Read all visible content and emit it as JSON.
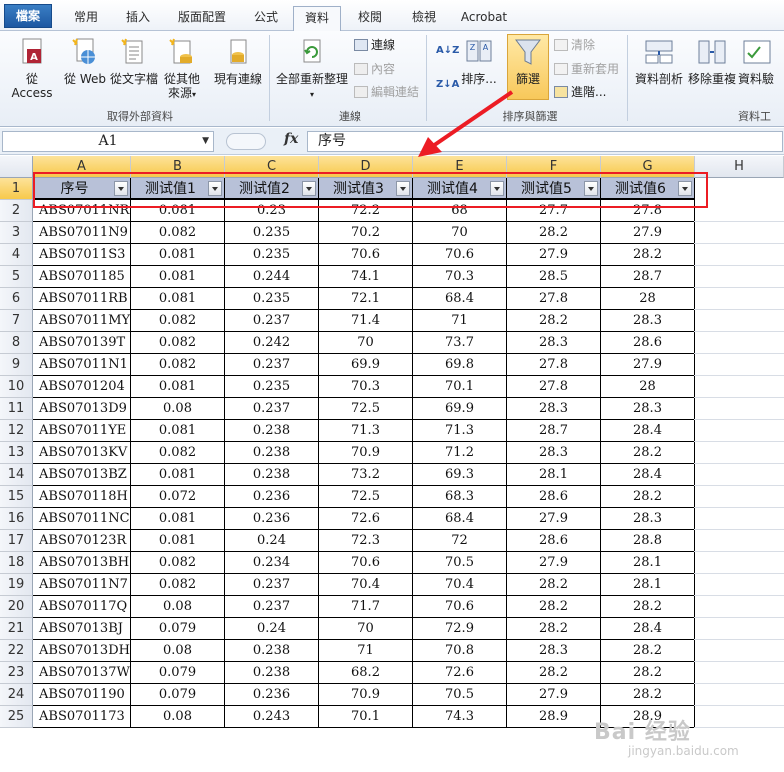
{
  "tabs": [
    "檔案",
    "常用",
    "插入",
    "版面配置",
    "公式",
    "資料",
    "校閱",
    "檢視",
    "Acrobat"
  ],
  "ribbon": {
    "get_external": {
      "buttons": [
        "從 Access",
        "從 Web",
        "從文字檔",
        "從其他",
        "來源",
        "現有連線"
      ],
      "label": "取得外部資料"
    },
    "connections": {
      "refresh_all": "全部重新整理",
      "connections": "連線",
      "properties": "內容",
      "edit_links": "編輯連結",
      "label": "連線"
    },
    "sort_filter": {
      "sort": "排序...",
      "filter": "篩選",
      "clear": "清除",
      "reapply": "重新套用",
      "advanced": "進階...",
      "label": "排序與篩選"
    },
    "data_tools": {
      "text_to_columns": "資料剖析",
      "remove_duplicates": "移除重複",
      "more": "資料驗",
      "label": "資料工"
    }
  },
  "formula_bar": {
    "name_box": "A1",
    "fx": "fx",
    "content": "序号"
  },
  "columns": [
    "A",
    "B",
    "C",
    "D",
    "E",
    "F",
    "G",
    "H"
  ],
  "headers": [
    "序号",
    "测试值1",
    "测试值2",
    "测试值3",
    "测试值4",
    "测试值5",
    "测试值6"
  ],
  "rows": [
    [
      "ABS07011NR",
      "0.081",
      "0.23",
      "72.2",
      "68",
      "27.7",
      "27.8"
    ],
    [
      "ABS07011N9",
      "0.082",
      "0.235",
      "70.2",
      "70",
      "28.2",
      "27.9"
    ],
    [
      "ABS07011S3",
      "0.081",
      "0.235",
      "70.6",
      "70.6",
      "27.9",
      "28.2"
    ],
    [
      "ABS0701185",
      "0.081",
      "0.244",
      "74.1",
      "70.3",
      "28.5",
      "28.7"
    ],
    [
      "ABS07011RB",
      "0.081",
      "0.235",
      "72.1",
      "68.4",
      "27.8",
      "28"
    ],
    [
      "ABS07011MY",
      "0.082",
      "0.237",
      "71.4",
      "71",
      "28.2",
      "28.3"
    ],
    [
      "ABS070139T",
      "0.082",
      "0.242",
      "70",
      "73.7",
      "28.3",
      "28.6"
    ],
    [
      "ABS07011N1",
      "0.082",
      "0.237",
      "69.9",
      "69.8",
      "27.8",
      "27.9"
    ],
    [
      "ABS0701204",
      "0.081",
      "0.235",
      "70.3",
      "70.1",
      "27.8",
      "28"
    ],
    [
      "ABS07013D9",
      "0.08",
      "0.237",
      "72.5",
      "69.9",
      "28.3",
      "28.3"
    ],
    [
      "ABS07011YE",
      "0.081",
      "0.238",
      "71.3",
      "71.3",
      "28.7",
      "28.4"
    ],
    [
      "ABS07013KV",
      "0.082",
      "0.238",
      "70.9",
      "71.2",
      "28.3",
      "28.2"
    ],
    [
      "ABS07013BZ",
      "0.081",
      "0.238",
      "73.2",
      "69.3",
      "28.1",
      "28.4"
    ],
    [
      "ABS070118H",
      "0.072",
      "0.236",
      "72.5",
      "68.3",
      "28.6",
      "28.2"
    ],
    [
      "ABS07011NC",
      "0.081",
      "0.236",
      "72.6",
      "68.4",
      "27.9",
      "28.3"
    ],
    [
      "ABS070123R",
      "0.081",
      "0.24",
      "72.3",
      "72",
      "28.6",
      "28.8"
    ],
    [
      "ABS07013BH",
      "0.082",
      "0.234",
      "70.6",
      "70.5",
      "27.9",
      "28.1"
    ],
    [
      "ABS07011N7",
      "0.082",
      "0.237",
      "70.4",
      "70.4",
      "28.2",
      "28.1"
    ],
    [
      "ABS070117Q",
      "0.08",
      "0.237",
      "71.7",
      "70.6",
      "28.2",
      "28.2"
    ],
    [
      "ABS07013BJ",
      "0.079",
      "0.24",
      "70",
      "72.9",
      "28.2",
      "28.4"
    ],
    [
      "ABS07013DH",
      "0.08",
      "0.238",
      "71",
      "70.8",
      "28.3",
      "28.2"
    ],
    [
      "ABS070137W",
      "0.079",
      "0.238",
      "68.2",
      "72.6",
      "28.2",
      "28.2"
    ],
    [
      "ABS0701190",
      "0.079",
      "0.236",
      "70.9",
      "70.5",
      "27.9",
      "28.2"
    ],
    [
      "ABS0701173",
      "0.08",
      "0.243",
      "70.1",
      "74.3",
      "28.9",
      "28.9"
    ]
  ],
  "watermark": {
    "main": "Bai 经验",
    "sub": "jingyan.baidu.com"
  },
  "colors": {
    "annotation": "#ec1c24",
    "header_fill": "#b8c1d8",
    "selected_col": "#f7c94b"
  }
}
